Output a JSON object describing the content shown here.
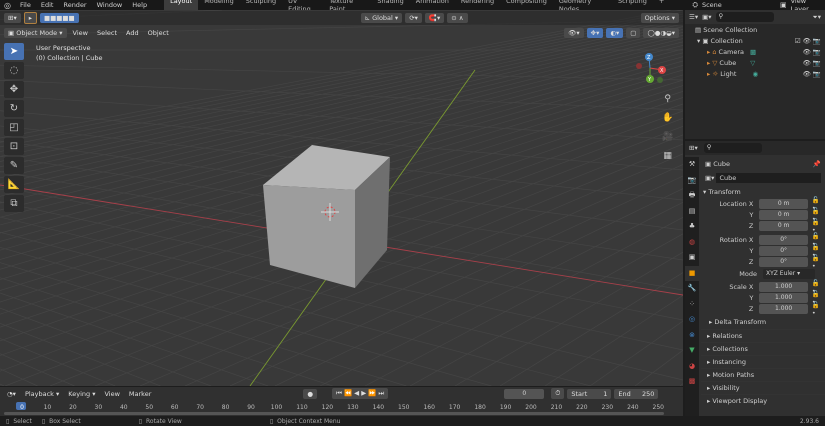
{
  "topbar": {
    "menus": [
      "File",
      "Edit",
      "Render",
      "Window",
      "Help"
    ],
    "workspaces": [
      "Layout",
      "Modeling",
      "Sculpting",
      "UV Editing",
      "Texture Paint",
      "Shading",
      "Animation",
      "Rendering",
      "Compositing",
      "Geometry Nodes",
      "Scripting"
    ],
    "active_workspace": "Layout",
    "scene": "Scene",
    "view_layer": "View Layer"
  },
  "viewport": {
    "orientation": "Global",
    "options": "Options",
    "mode": "Object Mode",
    "menus": [
      "View",
      "Select",
      "Add",
      "Object"
    ],
    "overlay_title": "User Perspective",
    "overlay_subtitle": "(0) Collection | Cube",
    "tools": [
      "select-box",
      "cursor",
      "move",
      "rotate",
      "scale",
      "transform",
      "annotate",
      "measure",
      "add-cube"
    ],
    "gizmo": {
      "x": "X",
      "y": "Y",
      "z": "Z"
    }
  },
  "outliner": {
    "root": "Scene Collection",
    "collection": "Collection",
    "items": [
      "Camera",
      "Cube",
      "Light"
    ]
  },
  "properties": {
    "object_name": "Cube",
    "data_name": "Cube",
    "transform": "Transform",
    "location": {
      "label": "Location X",
      "x": "0 m",
      "y": "0 m",
      "z": "0 m"
    },
    "rotation": {
      "label": "Rotation X",
      "x": "0°",
      "y": "0°",
      "z": "0°"
    },
    "mode_label": "Mode",
    "mode": "XYZ Euler",
    "scale": {
      "label": "Scale X",
      "x": "1.000",
      "y": "1.000",
      "z": "1.000"
    },
    "axis_y": "Y",
    "axis_z": "Z",
    "delta": "Delta Transform",
    "sections": [
      "Relations",
      "Collections",
      "Instancing",
      "Motion Paths",
      "Visibility",
      "Viewport Display"
    ]
  },
  "timeline": {
    "menus": [
      "Playback",
      "Keying",
      "View",
      "Marker"
    ],
    "current_frame": "0",
    "start_label": "Start",
    "start": "1",
    "end_label": "End",
    "end": "250",
    "ticks": [
      "0",
      "10",
      "20",
      "30",
      "40",
      "50",
      "60",
      "70",
      "80",
      "90",
      "100",
      "110",
      "120",
      "130",
      "140",
      "150",
      "160",
      "170",
      "180",
      "190",
      "200",
      "210",
      "220",
      "230",
      "240",
      "250"
    ]
  },
  "statusbar": {
    "select": "Select",
    "box_select": "Box Select",
    "rotate_view": "Rotate View",
    "context_menu": "Object Context Menu",
    "version": "2.93.6"
  },
  "colors": {
    "accent": "#4772b3",
    "x_axis": "#c0404a",
    "y_axis": "#7a9a30"
  }
}
